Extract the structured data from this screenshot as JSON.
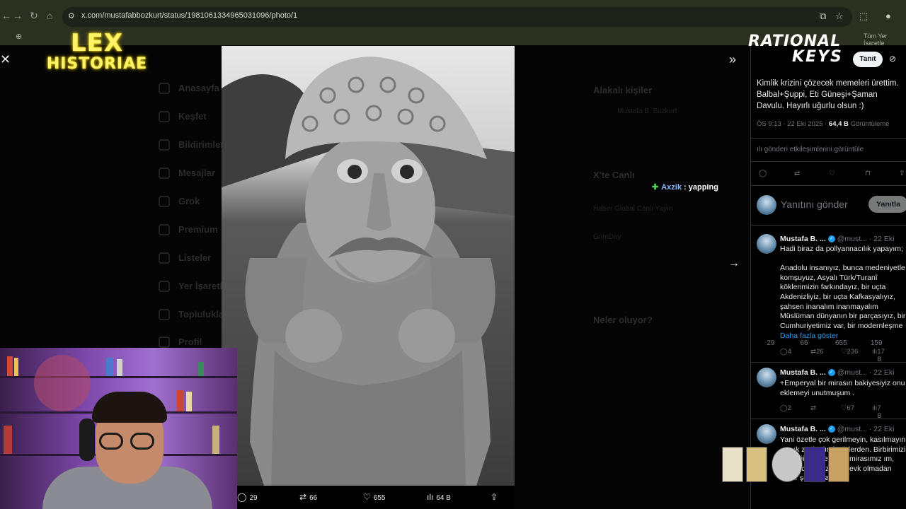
{
  "browser": {
    "url": "x.com/mustafabbozkurt/status/1981061334965031096/photo/1",
    "bookmarks_label": "Tüm Yer İşaretle"
  },
  "background_nav": [
    "Anasayfa",
    "Keşfet",
    "Bildirimler",
    "Mesajlar",
    "Grok",
    "Premium",
    "Listeler",
    "Yer İşaretleri",
    "Topluluklar",
    "Profil"
  ],
  "background_side": {
    "related_title": "Alakalı kişiler",
    "related_name": "Mustafa B. Bozkurt",
    "live_title": "X'te Canlı",
    "live_items": [
      "Haber Global Canlı Yayın",
      "GrimDay"
    ],
    "trends_title": "Neler oluyor?"
  },
  "logo": {
    "line1": "LEX",
    "line2": "HISTORIAE"
  },
  "photo_actions": {
    "replies": "29",
    "reposts": "66",
    "likes": "655",
    "views": "64 B"
  },
  "chat": {
    "user": "Axzik",
    "message": ": yapping"
  },
  "channel_logo": {
    "line1": "RATIONAL",
    "line2": "KEYS"
  },
  "tweet": {
    "author": "Mustafa B.",
    "follow_label": "Tanıt",
    "text": "Kimlik krizini çözecek memeleri ürettim. Balbal+Şuppi, Eti Güneşi+Şaman Davulu. Hayırlı uğurlu olsun :)",
    "time": "ÖS 9:13 · 22 Eki 2025 ·",
    "views_count": "64,4 B",
    "views_label": "Görüntüleme",
    "engagements_link": "gönderi etkileşimlerini görüntüle",
    "stats": {
      "replies": "29",
      "reposts": "66",
      "likes": "655",
      "bookmarks": "159"
    },
    "reply_placeholder": "Yanıtını gönder",
    "reply_button": "Yanıtla"
  },
  "replies": [
    {
      "name": "Mustafa B. ...",
      "handle": "@must...",
      "date": "· 22 Eki",
      "text": "Hadi biraz da pollyannacılık yapayım;\n\nAnadolu insanıyız, bunca medeniyetle komşuyuz, Asyalı Türk/Turanî köklerimizin farkındayız, bir uçta Akdenizliyiz, bir uçta Kafkasyalıyız, şahsen inanalım inanmayalım Müslüman dünyanın bir parçasıyız, bir Cumhuriyetimiz var, bir modernleşme",
      "more": "Daha fazla göster",
      "replies": "4",
      "reposts": "26",
      "likes": "236",
      "views": "17 B"
    },
    {
      "name": "Mustafa B. ...",
      "handle": "@must...",
      "date": "· 22 Eki",
      "text": "+Emperyal bir mirasın bakiyesiyiz onu eklemeyi unutmuşum .",
      "replies": "2",
      "reposts": "",
      "likes": "67",
      "views": "7 B"
    },
    {
      "name": "Mustafa B. ...",
      "handle": "@must...",
      "date": "· 22 Eki",
      "text": "Yani özetle çok gerilmeyin, kasılmayın azıcık zevk alın bu işlerden. Birbirimizi da değiliz sürekli. bir mirasımız ım, zevk edelim azıcık. Zevk olmadan hiçbir şey yaşamaz."
    }
  ]
}
